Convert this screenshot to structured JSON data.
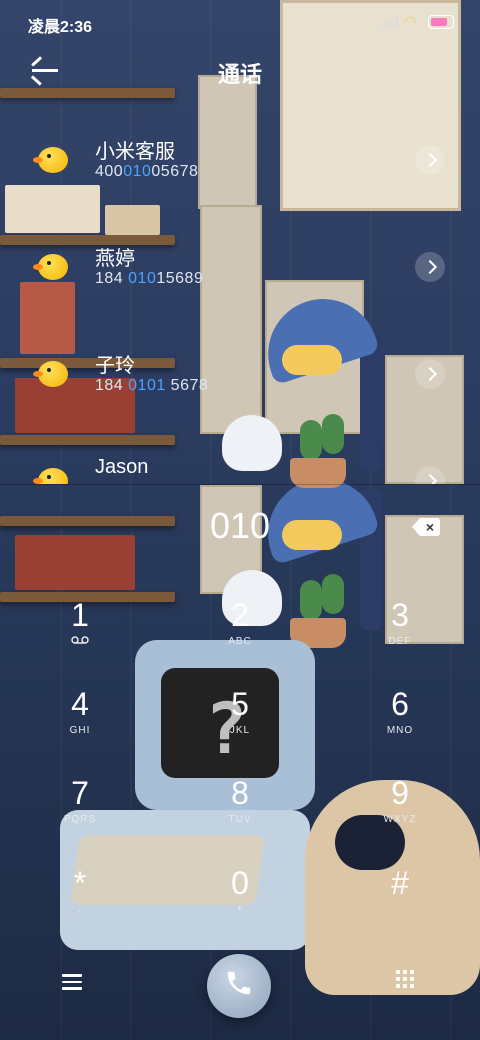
{
  "status_bar": {
    "time": "凌晨2:36"
  },
  "header": {
    "title": "通话"
  },
  "contacts": [
    {
      "name": "小米客服",
      "number_parts": [
        "400",
        "010",
        "05678"
      ]
    },
    {
      "name": "燕婷",
      "number_parts": [
        "184 ",
        "010",
        "15689"
      ]
    },
    {
      "name": "子玲",
      "number_parts": [
        "184 ",
        "0101",
        " 5678"
      ]
    },
    {
      "name": "Jason",
      "number_parts": [
        "",
        "",
        ""
      ]
    }
  ],
  "dialer": {
    "entered": "010",
    "keys": [
      {
        "digit": "1",
        "sub": "voicemail-icon"
      },
      {
        "digit": "2",
        "sub": "ABC"
      },
      {
        "digit": "3",
        "sub": "DEF"
      },
      {
        "digit": "4",
        "sub": "GHI"
      },
      {
        "digit": "5",
        "sub": "JKL"
      },
      {
        "digit": "6",
        "sub": "MNO"
      },
      {
        "digit": "7",
        "sub": "PQRS"
      },
      {
        "digit": "8",
        "sub": "TUV"
      },
      {
        "digit": "9",
        "sub": "WXYZ"
      },
      {
        "digit": "*",
        "sub": ","
      },
      {
        "digit": "0",
        "sub": "+"
      },
      {
        "digit": "#",
        "sub": ""
      }
    ]
  },
  "colors": {
    "highlight": "#4aa3ff",
    "background": "#2b3a5c"
  }
}
